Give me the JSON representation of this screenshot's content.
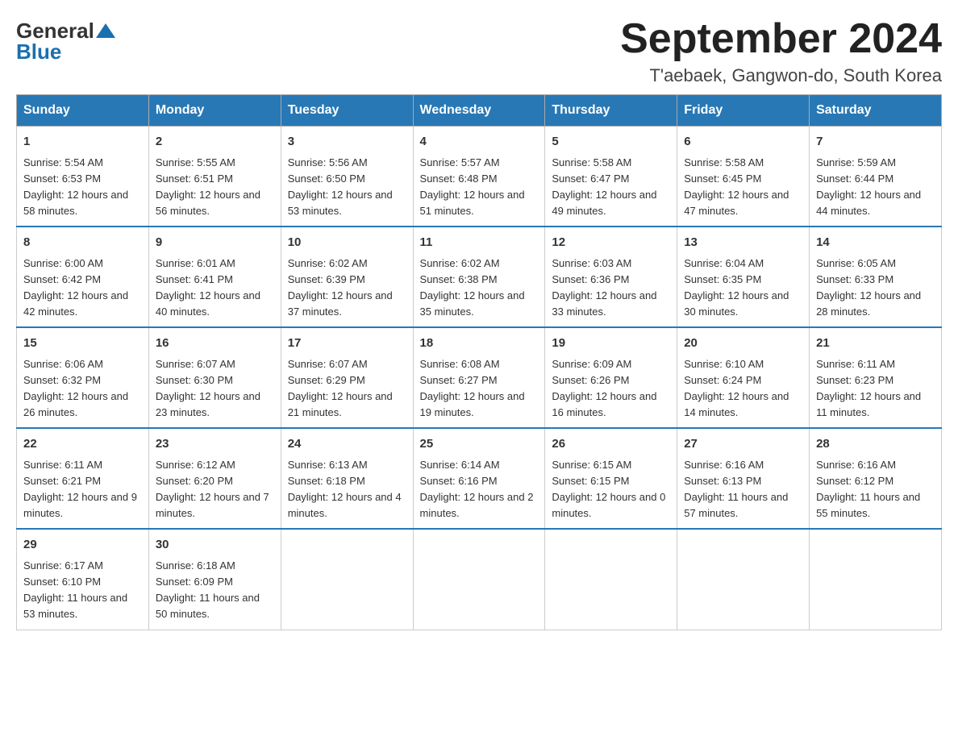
{
  "header": {
    "logo_general": "General",
    "logo_blue": "Blue",
    "main_title": "September 2024",
    "subtitle": "T'aebaek, Gangwon-do, South Korea"
  },
  "weekdays": [
    "Sunday",
    "Monday",
    "Tuesday",
    "Wednesday",
    "Thursday",
    "Friday",
    "Saturday"
  ],
  "weeks": [
    [
      {
        "day": "1",
        "sunrise": "5:54 AM",
        "sunset": "6:53 PM",
        "daylight": "12 hours and 58 minutes."
      },
      {
        "day": "2",
        "sunrise": "5:55 AM",
        "sunset": "6:51 PM",
        "daylight": "12 hours and 56 minutes."
      },
      {
        "day": "3",
        "sunrise": "5:56 AM",
        "sunset": "6:50 PM",
        "daylight": "12 hours and 53 minutes."
      },
      {
        "day": "4",
        "sunrise": "5:57 AM",
        "sunset": "6:48 PM",
        "daylight": "12 hours and 51 minutes."
      },
      {
        "day": "5",
        "sunrise": "5:58 AM",
        "sunset": "6:47 PM",
        "daylight": "12 hours and 49 minutes."
      },
      {
        "day": "6",
        "sunrise": "5:58 AM",
        "sunset": "6:45 PM",
        "daylight": "12 hours and 47 minutes."
      },
      {
        "day": "7",
        "sunrise": "5:59 AM",
        "sunset": "6:44 PM",
        "daylight": "12 hours and 44 minutes."
      }
    ],
    [
      {
        "day": "8",
        "sunrise": "6:00 AM",
        "sunset": "6:42 PM",
        "daylight": "12 hours and 42 minutes."
      },
      {
        "day": "9",
        "sunrise": "6:01 AM",
        "sunset": "6:41 PM",
        "daylight": "12 hours and 40 minutes."
      },
      {
        "day": "10",
        "sunrise": "6:02 AM",
        "sunset": "6:39 PM",
        "daylight": "12 hours and 37 minutes."
      },
      {
        "day": "11",
        "sunrise": "6:02 AM",
        "sunset": "6:38 PM",
        "daylight": "12 hours and 35 minutes."
      },
      {
        "day": "12",
        "sunrise": "6:03 AM",
        "sunset": "6:36 PM",
        "daylight": "12 hours and 33 minutes."
      },
      {
        "day": "13",
        "sunrise": "6:04 AM",
        "sunset": "6:35 PM",
        "daylight": "12 hours and 30 minutes."
      },
      {
        "day": "14",
        "sunrise": "6:05 AM",
        "sunset": "6:33 PM",
        "daylight": "12 hours and 28 minutes."
      }
    ],
    [
      {
        "day": "15",
        "sunrise": "6:06 AM",
        "sunset": "6:32 PM",
        "daylight": "12 hours and 26 minutes."
      },
      {
        "day": "16",
        "sunrise": "6:07 AM",
        "sunset": "6:30 PM",
        "daylight": "12 hours and 23 minutes."
      },
      {
        "day": "17",
        "sunrise": "6:07 AM",
        "sunset": "6:29 PM",
        "daylight": "12 hours and 21 minutes."
      },
      {
        "day": "18",
        "sunrise": "6:08 AM",
        "sunset": "6:27 PM",
        "daylight": "12 hours and 19 minutes."
      },
      {
        "day": "19",
        "sunrise": "6:09 AM",
        "sunset": "6:26 PM",
        "daylight": "12 hours and 16 minutes."
      },
      {
        "day": "20",
        "sunrise": "6:10 AM",
        "sunset": "6:24 PM",
        "daylight": "12 hours and 14 minutes."
      },
      {
        "day": "21",
        "sunrise": "6:11 AM",
        "sunset": "6:23 PM",
        "daylight": "12 hours and 11 minutes."
      }
    ],
    [
      {
        "day": "22",
        "sunrise": "6:11 AM",
        "sunset": "6:21 PM",
        "daylight": "12 hours and 9 minutes."
      },
      {
        "day": "23",
        "sunrise": "6:12 AM",
        "sunset": "6:20 PM",
        "daylight": "12 hours and 7 minutes."
      },
      {
        "day": "24",
        "sunrise": "6:13 AM",
        "sunset": "6:18 PM",
        "daylight": "12 hours and 4 minutes."
      },
      {
        "day": "25",
        "sunrise": "6:14 AM",
        "sunset": "6:16 PM",
        "daylight": "12 hours and 2 minutes."
      },
      {
        "day": "26",
        "sunrise": "6:15 AM",
        "sunset": "6:15 PM",
        "daylight": "12 hours and 0 minutes."
      },
      {
        "day": "27",
        "sunrise": "6:16 AM",
        "sunset": "6:13 PM",
        "daylight": "11 hours and 57 minutes."
      },
      {
        "day": "28",
        "sunrise": "6:16 AM",
        "sunset": "6:12 PM",
        "daylight": "11 hours and 55 minutes."
      }
    ],
    [
      {
        "day": "29",
        "sunrise": "6:17 AM",
        "sunset": "6:10 PM",
        "daylight": "11 hours and 53 minutes."
      },
      {
        "day": "30",
        "sunrise": "6:18 AM",
        "sunset": "6:09 PM",
        "daylight": "11 hours and 50 minutes."
      },
      null,
      null,
      null,
      null,
      null
    ]
  ]
}
